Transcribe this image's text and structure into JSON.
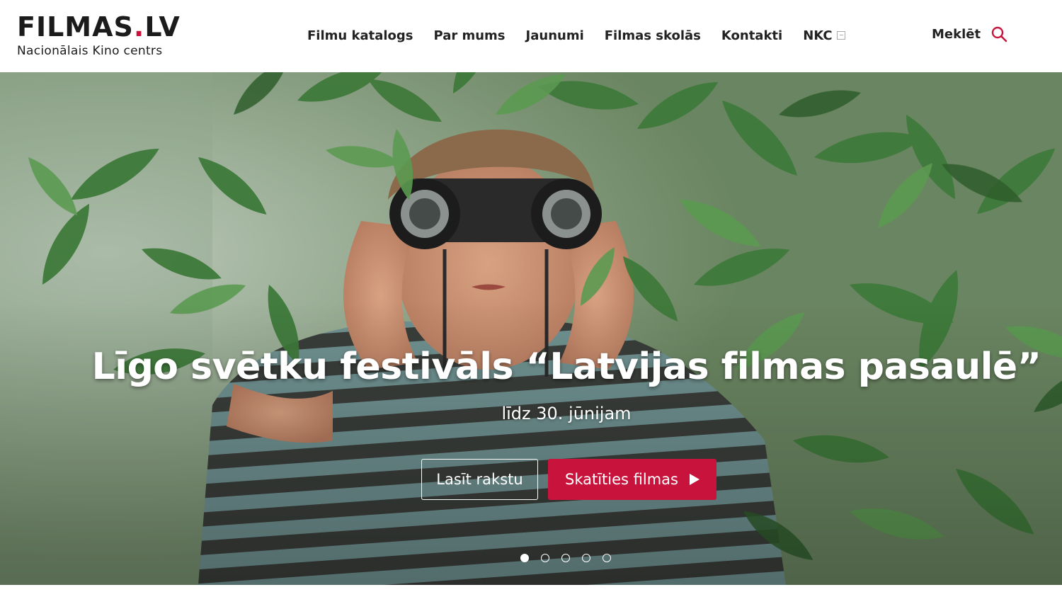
{
  "header": {
    "logo_title_main": "FILMAS",
    "logo_title_dot": ".",
    "logo_title_tld": "LV",
    "logo_subtitle": "Nacionālais Kino centrs",
    "nav": [
      "Filmu katalogs",
      "Par mums",
      "Jaunumi",
      "Filmas skolās",
      "Kontakti",
      "NKC"
    ],
    "nav_external_icon": "external-link-icon",
    "search_label": "Meklēt",
    "search_icon": "search-icon"
  },
  "hero": {
    "title": "Līgo svētku festivāls “Latvijas filmas pasaulē”",
    "subtitle": "līdz 30. jūnijam",
    "read_button": "Lasīt rakstu",
    "watch_button": "Skatīties filmas",
    "watch_icon": "play-icon",
    "slides_total": 5,
    "active_slide": 1
  },
  "colors": {
    "accent": "#c8143c",
    "text": "#1b1b1b"
  }
}
